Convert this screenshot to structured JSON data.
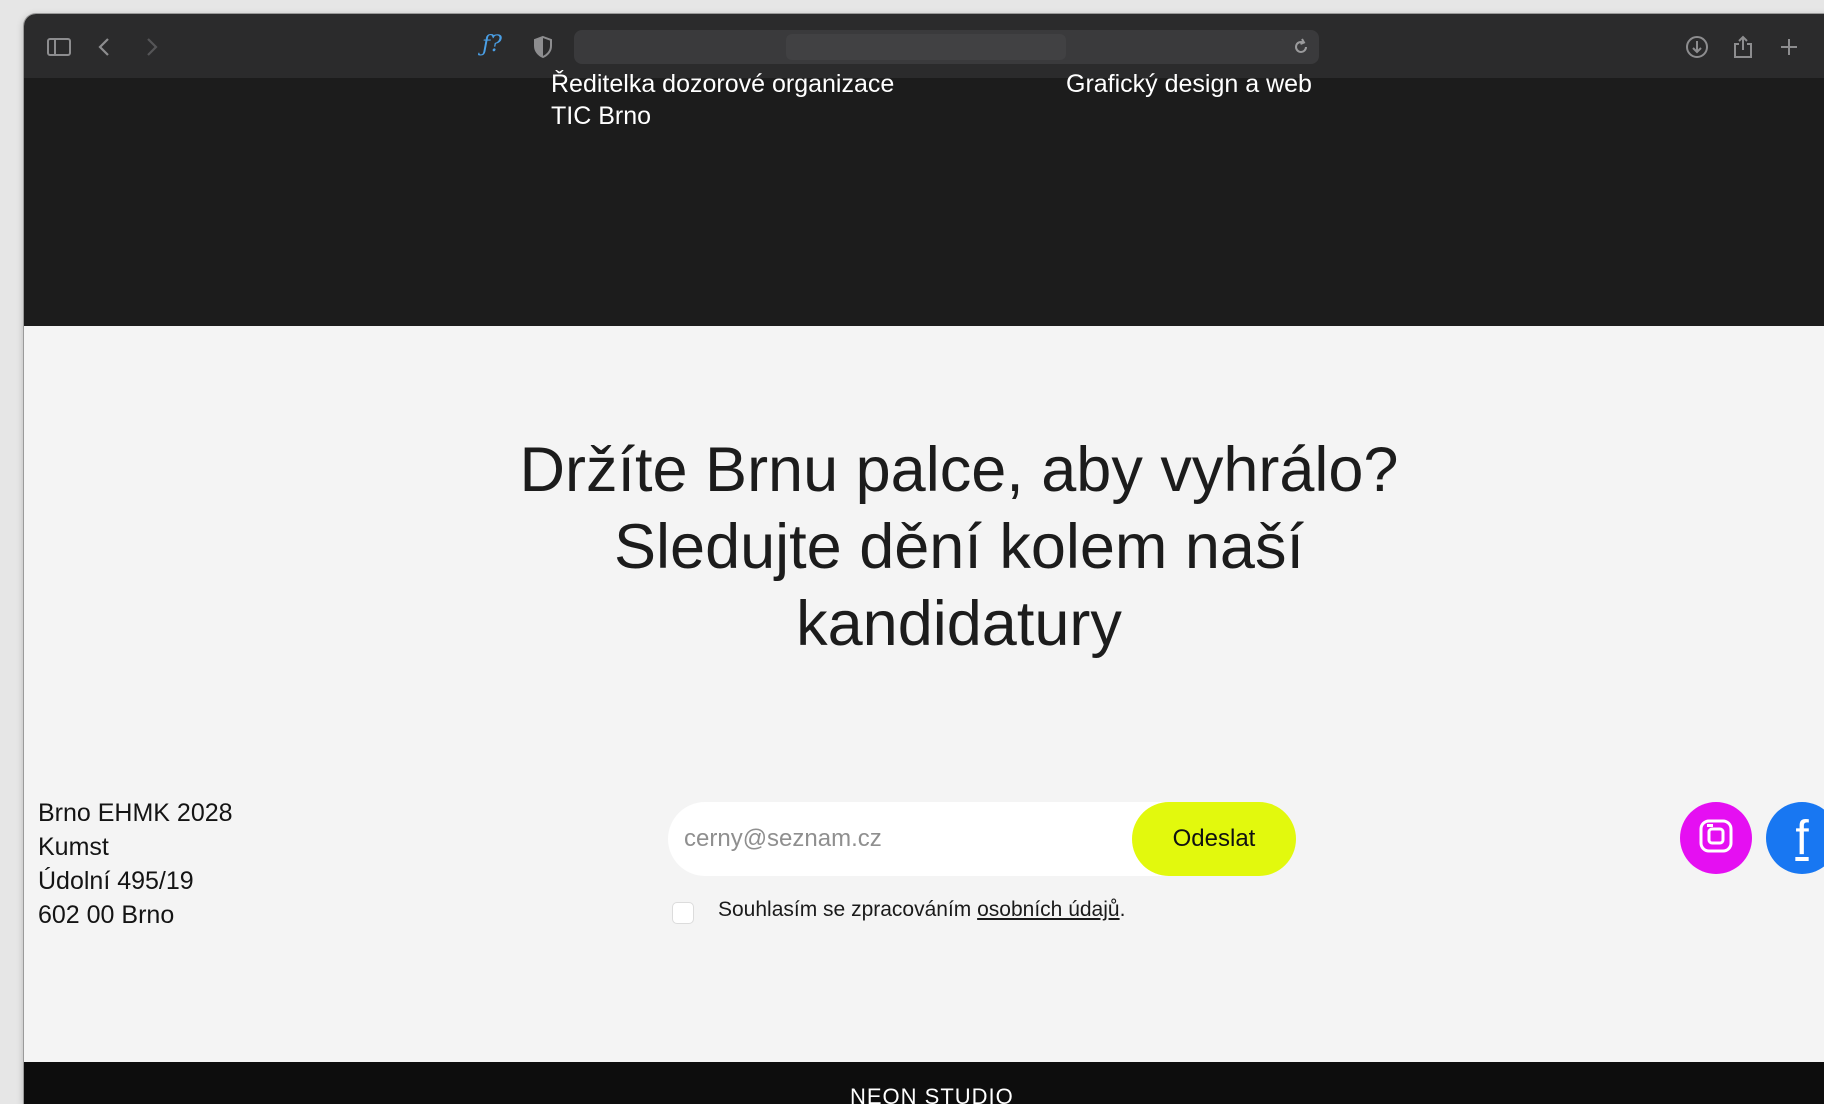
{
  "browser": {
    "icons": [
      "sidebar-icon",
      "back-icon",
      "forward-icon",
      "fx-extension-icon",
      "shield-icon",
      "reload-icon",
      "download-icon",
      "share-icon",
      "new-tab-icon"
    ],
    "extension_label": "ƒ?"
  },
  "credits": {
    "left_line1": "Ředitelka dozorové organizace",
    "left_line2": "TIC Brno",
    "right_line1": "Grafický design a web"
  },
  "headline": "Držíte Brnu palce, aby vyhrálo? Sledujte dění kolem naší kandidatury",
  "address": {
    "line1": "Brno EHMK 2028",
    "line2": "Kumst",
    "line3": "Údolní 495/19",
    "line4": "602 00 Brno"
  },
  "newsletter": {
    "placeholder": "cerny@seznam.cz",
    "value": "",
    "submit_label": "Odeslat",
    "consent_prefix": "Souhlasím se zpracováním ",
    "consent_link": "osobních údajů",
    "consent_suffix": ".",
    "checked": false,
    "accent_color": "#e2f90d"
  },
  "social": {
    "instagram_color": "#e50ff2",
    "facebook_color": "#1877f2",
    "facebook_glyph": "f"
  },
  "footer": {
    "text": "NEON STUDIO"
  }
}
